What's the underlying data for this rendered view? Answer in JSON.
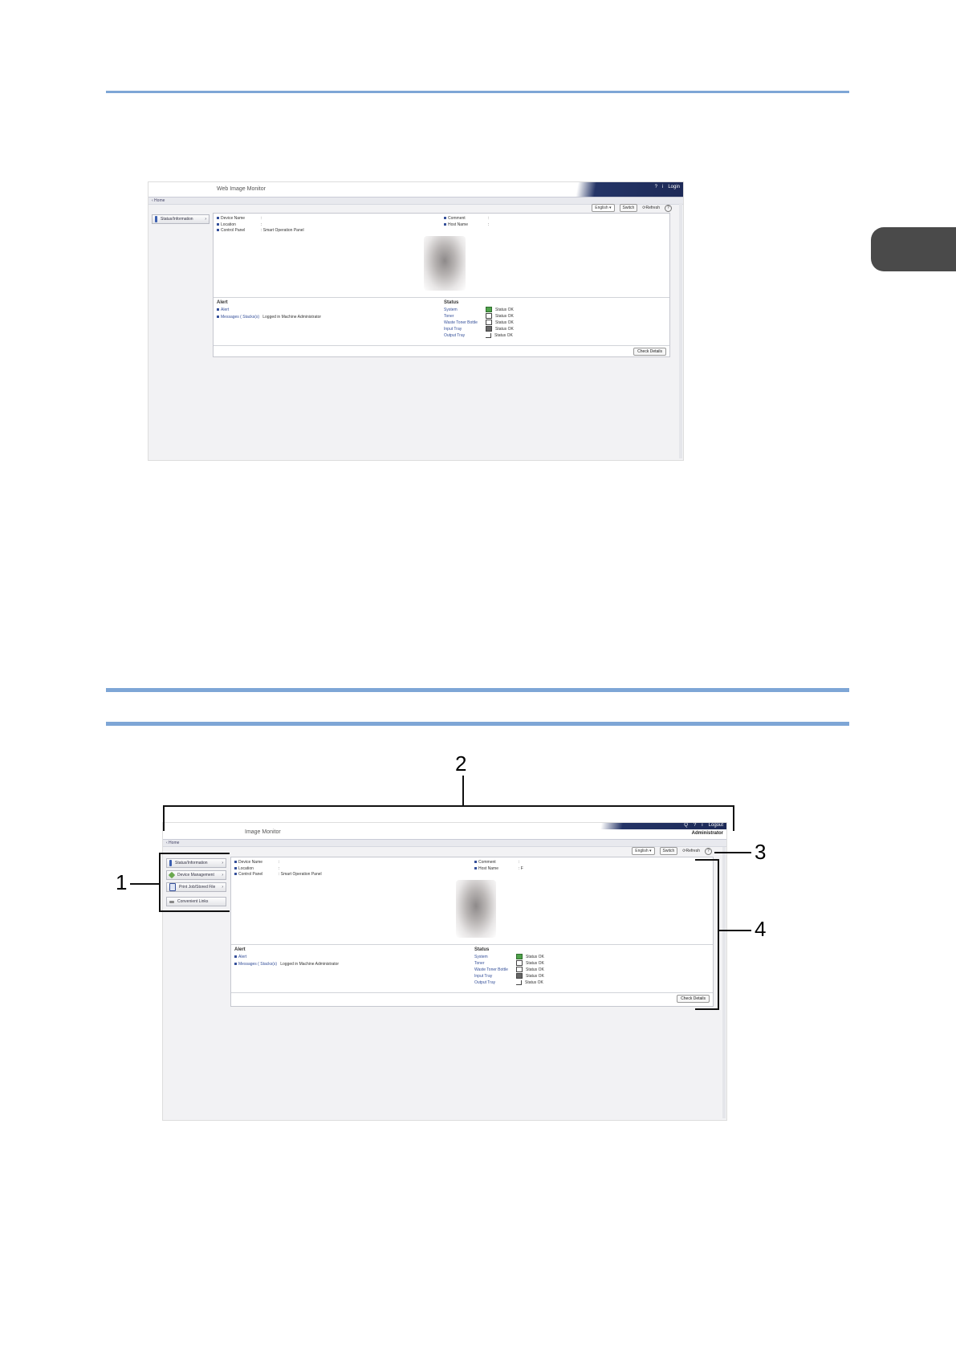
{
  "top_shot": {
    "title": "Web Image Monitor",
    "header_links": [
      "?",
      "i",
      "Login"
    ],
    "breadcrumb": "‹ Home",
    "language": "English",
    "switch_label": "Switch",
    "refresh_label": "Refresh",
    "help_label": "?",
    "nav": [
      "Status/Information"
    ],
    "fields_left": [
      {
        "label": "Device Name",
        "value": ":"
      },
      {
        "label": "Location",
        "value": ":"
      },
      {
        "label": "Control Panel",
        "value": ": Smart Operation Panel"
      }
    ],
    "fields_right": [
      {
        "label": "Comment",
        "value": ":"
      },
      {
        "label": "Host Name",
        "value": ":"
      }
    ],
    "alert_title": "Alert",
    "alert_items": [
      "Alert",
      "Messages ( Stacks(s)"
    ],
    "alert_message": "Logged in Machine Administrator",
    "status_title": "Status",
    "status_items": [
      {
        "label": "System",
        "value": "Status OK"
      },
      {
        "label": "Toner",
        "value": "Status OK"
      },
      {
        "label": "Waste Toner Bottle",
        "value": "Status OK"
      },
      {
        "label": "Input Tray",
        "value": "Status OK"
      },
      {
        "label": "Output Tray",
        "value": "Status OK"
      }
    ],
    "footer_button": "Check Details"
  },
  "bottom_shot": {
    "title": "Image Monitor",
    "header_links": [
      "Q",
      "?",
      "i",
      "Logout"
    ],
    "user": "Administrator",
    "breadcrumb": "‹ Home",
    "language": "English",
    "switch_label": "Switch",
    "refresh_label": "Refresh",
    "help_label": "?",
    "nav": [
      "Status/Information",
      "Device Management",
      "Print Job/Stored File",
      "Convenient Links"
    ],
    "fields_left": [
      {
        "label": "Device Name",
        "value": ":"
      },
      {
        "label": "Location",
        "value": ":"
      },
      {
        "label": "Control Panel",
        "value": ": Smart Operation Panel"
      }
    ],
    "fields_right": [
      {
        "label": "Comment",
        "value": ":"
      },
      {
        "label": "Host Name",
        "value": ": F"
      }
    ],
    "alert_title": "Alert",
    "alert_items": [
      "Alert",
      "Messages ( Stacks(s)"
    ],
    "alert_message": "Logged in Machine Administrator",
    "status_title": "Status",
    "status_items": [
      {
        "label": "System",
        "value": "Status OK"
      },
      {
        "label": "Toner",
        "value": "Status OK"
      },
      {
        "label": "Waste Toner Bottle",
        "value": "Status OK"
      },
      {
        "label": "Input Tray",
        "value": "Status OK"
      },
      {
        "label": "Output Tray",
        "value": "Status OK"
      }
    ],
    "footer_button": "Check Details"
  },
  "callouts": [
    "1",
    "2",
    "3",
    "4"
  ],
  "colors": {
    "rule": "#7ea6d6",
    "header_navy": "#1d2a57",
    "tab": "#4a4a4a"
  }
}
